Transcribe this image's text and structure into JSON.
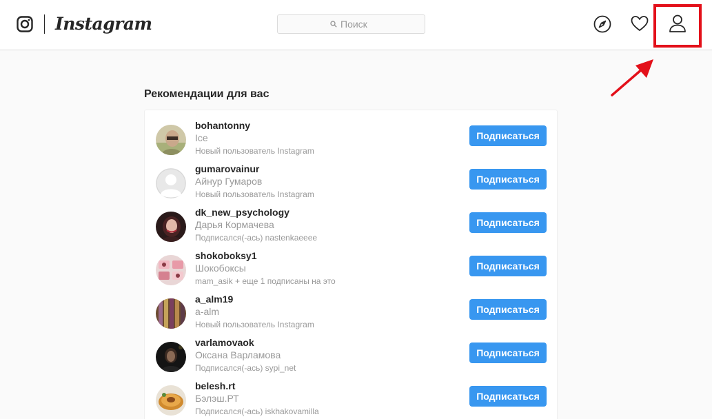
{
  "header": {
    "logo_text": "Instagram",
    "search_placeholder": "Поиск"
  },
  "main": {
    "title": "Рекомендации для вас",
    "follow_label": "Подписаться",
    "suggestions": [
      {
        "username": "bohantonny",
        "full_name": "Ice",
        "context": "Новый пользователь Instagram"
      },
      {
        "username": "gumarovainur",
        "full_name": "Айнур Гумаров",
        "context": "Новый пользователь Instagram"
      },
      {
        "username": "dk_new_psychology",
        "full_name": "Дарья Кормачева",
        "context": "Подписался(-ась) nastenkaeeee"
      },
      {
        "username": "shokoboksy1",
        "full_name": "Шокобоксы",
        "context": "mam_asik + еще 1 подписаны на это"
      },
      {
        "username": "a_alm19",
        "full_name": "a-alm",
        "context": "Новый пользователь Instagram"
      },
      {
        "username": "varlamovaok",
        "full_name": "Оксана Варламова",
        "context": "Подписался(-ась) sypi_net"
      },
      {
        "username": "belesh.rt",
        "full_name": "Бэлэш.РТ",
        "context": "Подписался(-ась) iskhakovamilla"
      }
    ]
  },
  "colors": {
    "accent": "#3897f0",
    "highlight": "#e3101a",
    "background": "#fafafa"
  }
}
